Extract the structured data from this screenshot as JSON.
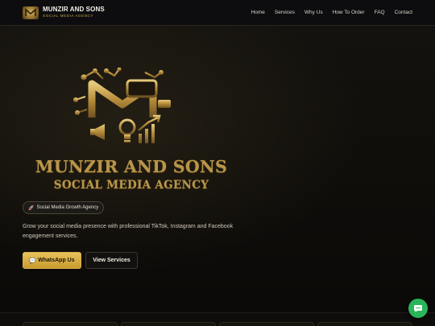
{
  "brand": {
    "name": "MUNZIR AND SONS",
    "tagline": "SOCIAL MEDIA AGENCY"
  },
  "nav": {
    "items": [
      {
        "label": "Home"
      },
      {
        "label": "Services"
      },
      {
        "label": "Why Us"
      },
      {
        "label": "How To Order"
      },
      {
        "label": "FAQ"
      },
      {
        "label": "Contact"
      }
    ]
  },
  "hero": {
    "logo_title": "MUNZIR AND SONS",
    "logo_subtitle": "SOCIAL MEDIA AGENCY",
    "badge_icon": "rocket-icon",
    "badge_label": "Social Media Growth Agency",
    "description": "Grow your social media presence with professional TikTok, Instagram and Facebook engagement services.",
    "primary_button": {
      "icon": "chat-icon",
      "label": "WhatsApp Us"
    },
    "secondary_button": {
      "label": "View Services"
    }
  },
  "floating_button": {
    "icon": "whatsapp-chat-icon"
  },
  "colors": {
    "accent_gold": "#c99a2e",
    "background": "#0b0a08",
    "whatsapp_green": "#2bb55a"
  }
}
